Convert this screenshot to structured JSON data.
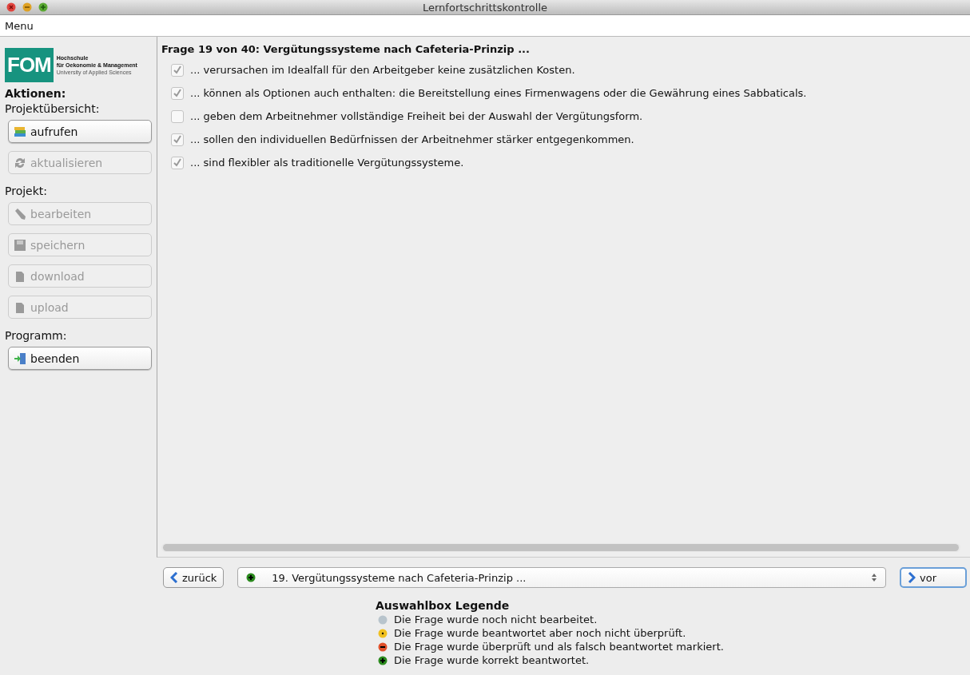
{
  "window": {
    "title": "Lernfortschrittskontrolle"
  },
  "menu": [
    "Menu"
  ],
  "logo": {
    "mark": "FOM",
    "lines": [
      "Hochschule",
      "für Oekonomie & Management",
      "University of Applied Sciences"
    ]
  },
  "sidebar": {
    "heading": "Aktionen:",
    "sections": [
      {
        "label": "Projektübersicht:",
        "buttons": [
          {
            "label": "aufrufen",
            "kind": "books",
            "disabled": false
          },
          {
            "label": "aktualisieren",
            "kind": "refresh",
            "disabled": true
          }
        ]
      },
      {
        "label": "Projekt:",
        "buttons": [
          {
            "label": "bearbeiten",
            "kind": "pencil",
            "disabled": true
          },
          {
            "label": "speichern",
            "kind": "disk",
            "disabled": true
          },
          {
            "label": "download",
            "kind": "file",
            "disabled": true
          },
          {
            "label": "upload",
            "kind": "file",
            "disabled": true
          }
        ]
      },
      {
        "label": "Programm:",
        "buttons": [
          {
            "label": "beenden",
            "kind": "exit",
            "disabled": false
          }
        ]
      }
    ]
  },
  "question": {
    "title": "Frage 19 von 40: Vergütungssysteme nach Cafeteria-Prinzip ...",
    "answers": [
      {
        "text": "... verursachen im Idealfall für den Arbeitgeber keine zusätzlichen Kosten.",
        "checked": true
      },
      {
        "text": "... können als Optionen auch enthalten: die Bereitstellung eines Firmenwagens oder die Gewährung eines Sabbaticals.",
        "checked": true
      },
      {
        "text": "... geben dem Arbeitnehmer vollständige Freiheit bei der Auswahl der Vergütungsform.",
        "checked": false
      },
      {
        "text": "... sollen den individuellen Bedürfnissen der Arbeitnehmer stärker entgegenkommen.",
        "checked": true
      },
      {
        "text": "... sind flexibler als traditionelle Vergütungssysteme.",
        "checked": true
      }
    ]
  },
  "navigation": {
    "back": "zurück",
    "forward": "vor",
    "select": {
      "value": "19. Vergütungssysteme nach Cafeteria-Prinzip ...",
      "kind": "correct"
    }
  },
  "legend": {
    "title": "Auswahlbox Legende",
    "items": [
      {
        "kind": "open",
        "text": "Die Frage wurde noch nicht bearbeitet."
      },
      {
        "kind": "answered",
        "text": "Die Frage wurde beantwortet aber noch nicht überprüft."
      },
      {
        "kind": "wrong",
        "text": "Die Frage wurde überprüft und als falsch beantwortet markiert."
      },
      {
        "kind": "correct",
        "text": "Die Frage wurde korrekt beantwortet."
      }
    ]
  }
}
